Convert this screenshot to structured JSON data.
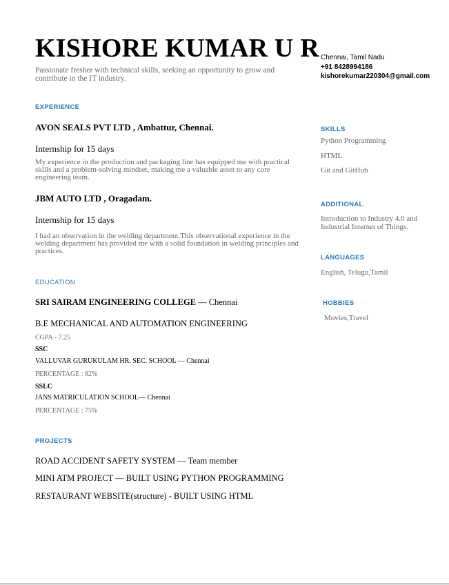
{
  "header": {
    "name": "KISHORE KUMAR U R",
    "tagline": "Passionate fresher with technical skills, seeking an opportunity to grow and contribute in the IT industry.",
    "location": "Chennai, Tamil Nadu",
    "phone": "+91 8428994186",
    "email": "kishorekumar220304@gmail.com"
  },
  "experience": {
    "heading": "EXPERIENCE",
    "items": [
      {
        "company": "AVON SEALS PVT LTD , Ambattur, Chennai.",
        "role": "Internship for 15 days",
        "description": "My experience in the production and packaging line has equipped me with practical skills and a problem-solving mindset, making me a valuable asset to any core engineering team."
      },
      {
        "company": "JBM AUTO LTD , Oragadam.",
        "role": "Internship for 15 days",
        "description": "I had an  observation in the welding department.This observational experience in the welding department has provided me with a solid foundation in welding principles and practices."
      }
    ]
  },
  "education": {
    "heading": "EDUCATION",
    "college_name": "SRI SAIRAM ENGINEERING COLLEGE",
    "college_city": " — Chennai",
    "degree": "B.E MECHANICAL AND AUTOMATION ENGINEERING",
    "cgpa": "CGPA - 7.25",
    "ssc_label": "SSC",
    "ssc_school": "VALLUVAR GURUKULAM HR. SEC. SCHOOL  — Chennai",
    "ssc_percentage": "PERCENTAGE : 82%",
    "sslc_label": "SSLC",
    "sslc_school": "JANS MATRICULATION SCHOOL— Chennai",
    "sslc_percentage": "PERCENTAGE : 75%"
  },
  "projects": {
    "heading": "PROJECTS",
    "items": [
      "ROAD ACCIDENT SAFETY SYSTEM — Team member",
      "MINI ATM PROJECT — BUILT USING PYTHON PROGRAMMING",
      "RESTAURANT WEBSITE(structure) - BUILT USING HTML"
    ]
  },
  "skills": {
    "heading": "SKILLS",
    "items": [
      "Python Programming",
      "HTML",
      "Git and GitHub"
    ]
  },
  "additional": {
    "heading": "ADDITIONAL",
    "text": "Introduction to Industry 4.0 and Industrial Internet of Things."
  },
  "languages": {
    "heading": "LANGUAGES",
    "text": "English, Telugu,Tamil"
  },
  "hobbies": {
    "heading": "HOBBIES",
    "text": "Movies,Travel"
  },
  "colors": {
    "accent": "#2b79b5",
    "muted_text": "#666666"
  }
}
